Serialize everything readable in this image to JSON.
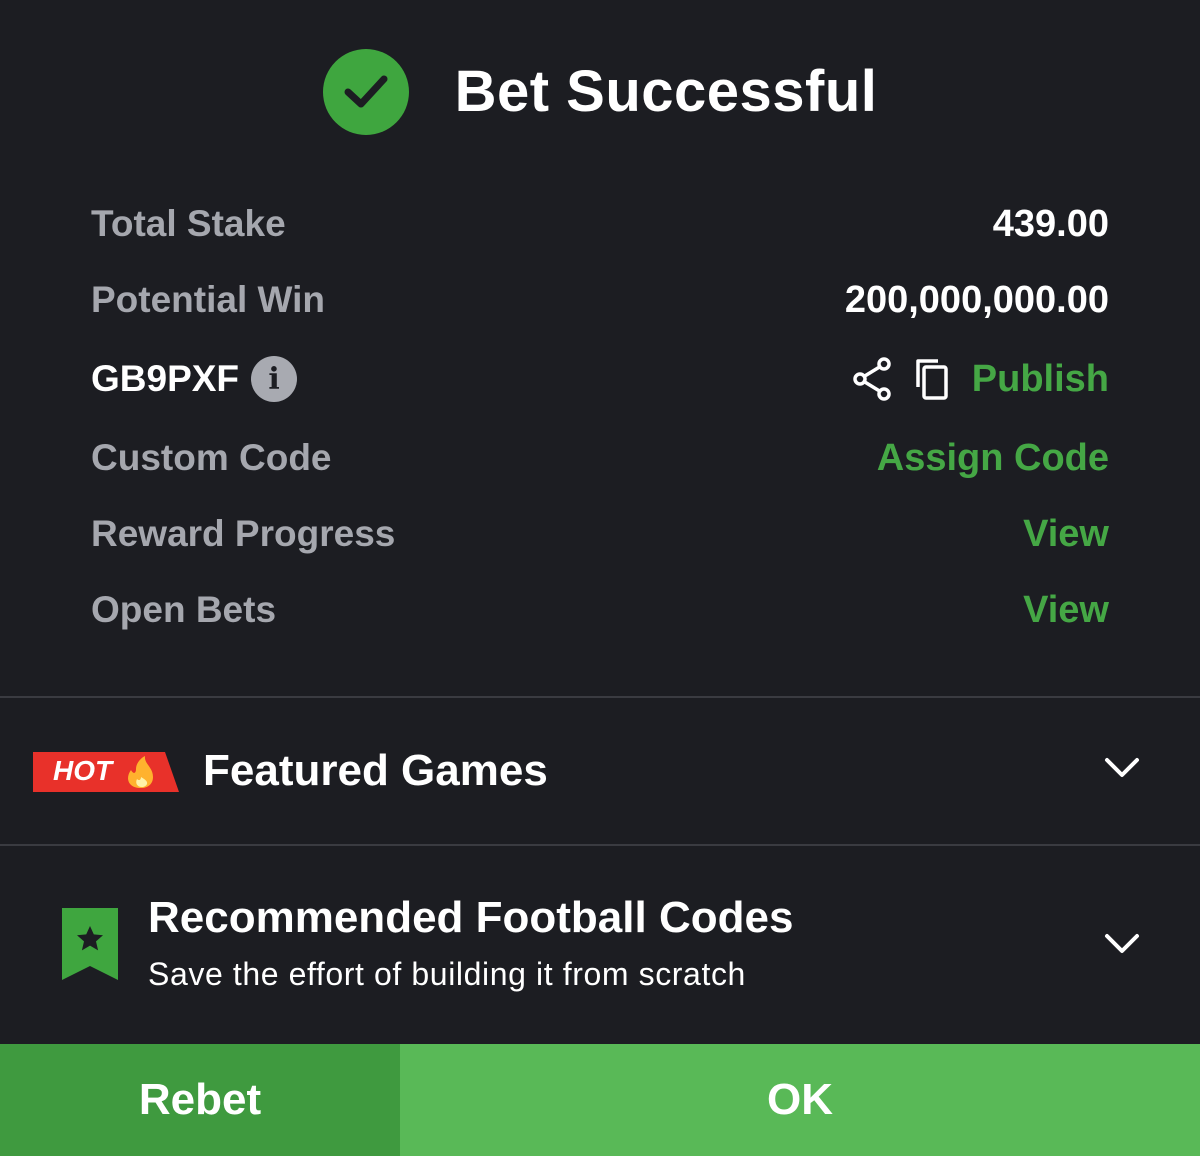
{
  "header": {
    "title": "Bet Successful",
    "icon": "check-circle-icon"
  },
  "summary": {
    "total_stake_label": "Total Stake",
    "total_stake_value": "439.00",
    "potential_win_label": "Potential Win",
    "potential_win_value": "200,000,000.00",
    "booking_code": "GB9PXF",
    "info_glyph": "i",
    "publish_label": "Publish",
    "custom_code_label": "Custom Code",
    "assign_code_label": "Assign Code",
    "reward_progress_label": "Reward Progress",
    "reward_progress_link": "View",
    "open_bets_label": "Open Bets",
    "open_bets_link": "View"
  },
  "featured": {
    "badge": "HOT",
    "title": "Featured Games"
  },
  "recommended": {
    "title": "Recommended Football Codes",
    "subtitle": "Save the effort of building it from scratch"
  },
  "footer": {
    "rebet_label": "Rebet",
    "ok_label": "OK"
  },
  "colors": {
    "background": "#1c1d22",
    "accent_green": "#45a745",
    "rebet_bg": "#3f9a3f",
    "ok_bg": "#59b957",
    "hot_red": "#e8312a",
    "muted_text": "#a5a7ae"
  }
}
